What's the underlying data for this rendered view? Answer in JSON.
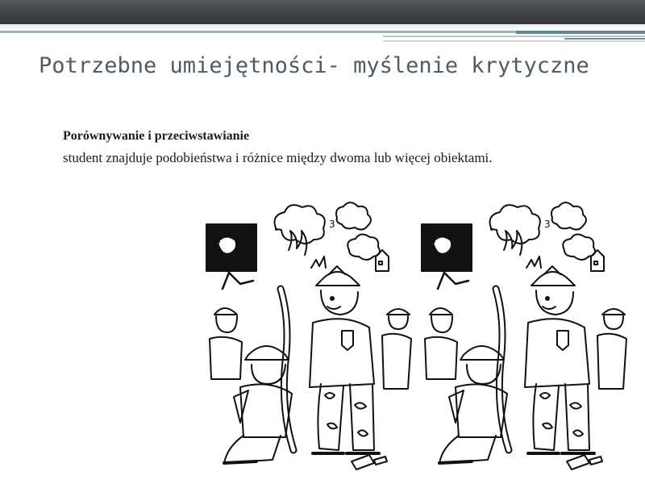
{
  "slide": {
    "title": "Potrzebne umiejętności- myślenie krytyczne",
    "subtitle": "Porównywanie i przeciwstawianie",
    "body": "student znajduje podobieństwa i różnice między dwoma lub więcej obiektami."
  },
  "images": [
    {
      "name": "spot-the-difference-cartoon-left",
      "description_icon": "firefighters-cartoon"
    },
    {
      "name": "spot-the-difference-cartoon-right",
      "description_icon": "firefighters-cartoon"
    }
  ],
  "colors": {
    "top_bar": "#3f4246",
    "accent_line": "#8aa9ad",
    "title_text": "#4e5a66",
    "body_text": "#1b1b1b"
  }
}
